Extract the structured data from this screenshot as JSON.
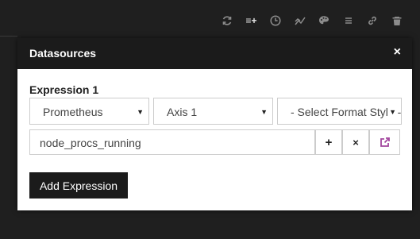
{
  "toolbar": {
    "icons": [
      "refresh-icon",
      "add-list-icon",
      "clock-icon",
      "line-chart-icon",
      "palette-icon",
      "menu-icon",
      "link-icon",
      "trash-icon"
    ],
    "add_list_label": "≡+"
  },
  "modal": {
    "title": "Datasources",
    "close_label": "×"
  },
  "expression": {
    "title": "Expression 1",
    "datasource": "Prometheus",
    "axis": "Axis 1",
    "format": "- Select Format Style -",
    "query": "node_procs_running",
    "plus_label": "+",
    "remove_label": "×"
  },
  "add_button_label": "Add Expression",
  "colors": {
    "background": "#1f1f1f",
    "modal_header": "#1b1b1b",
    "accent": "#a3489f"
  }
}
